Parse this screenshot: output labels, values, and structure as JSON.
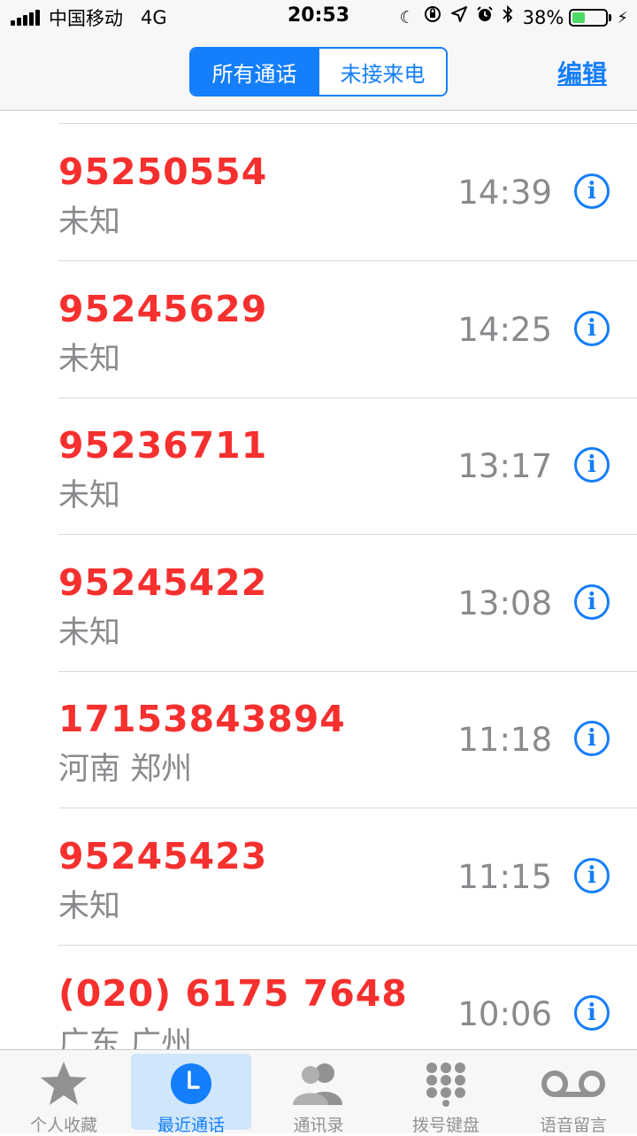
{
  "status_bar": {
    "carrier": "中国移动",
    "network": "4G",
    "time": "20:53",
    "battery_percent": "38%",
    "battery_level": 0.38,
    "icons": [
      "moon-icon",
      "orientation-lock-icon",
      "location-arrow-icon",
      "alarm-icon",
      "bluetooth-icon",
      "charging-bolt-icon"
    ]
  },
  "nav": {
    "segment_all": "所有通话",
    "segment_missed": "未接来电",
    "edit": "编辑"
  },
  "calls": [
    {
      "number": "95250554",
      "location": "未知",
      "time": "14:39"
    },
    {
      "number": "95245629",
      "location": "未知",
      "time": "14:25"
    },
    {
      "number": "95236711",
      "location": "未知",
      "time": "13:17"
    },
    {
      "number": "95245422",
      "location": "未知",
      "time": "13:08"
    },
    {
      "number": "17153843894",
      "location": "河南 郑州",
      "time": "11:18"
    },
    {
      "number": "95245423",
      "location": "未知",
      "time": "11:15"
    },
    {
      "number": "(020) 6175 7648",
      "location": "广东 广州",
      "time": "10:06"
    }
  ],
  "info_glyph": "i",
  "tabs": [
    {
      "label": "个人收藏",
      "icon": "star-icon",
      "active": false
    },
    {
      "label": "最近通话",
      "icon": "clock-icon",
      "active": true
    },
    {
      "label": "通讯录",
      "icon": "contacts-icon",
      "active": false
    },
    {
      "label": "拨号键盘",
      "icon": "keypad-icon",
      "active": false
    },
    {
      "label": "语音留言",
      "icon": "voicemail-icon",
      "active": false
    }
  ],
  "colors": {
    "accent": "#147efb",
    "missed_call": "#f5302e",
    "secondary_text": "#8a8a8e",
    "battery_green": "#4cd964"
  }
}
